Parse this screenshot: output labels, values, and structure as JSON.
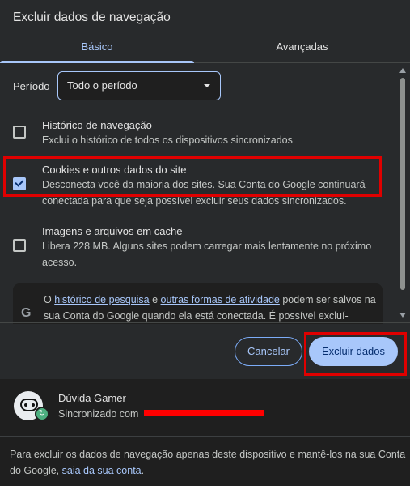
{
  "dialog": {
    "title": "Excluir dados de navegação"
  },
  "tabs": [
    {
      "label": "Básico",
      "active": true
    },
    {
      "label": "Avançadas",
      "active": false
    }
  ],
  "period": {
    "label": "Período",
    "selected": "Todo o período"
  },
  "options": [
    {
      "title": "Histórico de navegação",
      "desc": "Exclui o histórico de todos os dispositivos sincronizados",
      "checked": false
    },
    {
      "title": "Cookies e outros dados do site",
      "desc": "Desconecta você da maioria dos sites. Sua Conta do Google continuará conectada para que seja possível excluir seus dados sincronizados.",
      "checked": true
    },
    {
      "title": "Imagens e arquivos em cache",
      "desc": "Libera 228 MB. Alguns sites podem carregar mais lentamente no próximo acesso.",
      "checked": false
    }
  ],
  "info": {
    "prefix": "O ",
    "link1": "histórico de pesquisa",
    "mid": " e ",
    "link2": "outras formas de atividade",
    "suffix": " podem ser salvos na sua Conta do Google quando ela está conectada. É possível excluí-"
  },
  "buttons": {
    "cancel": "Cancelar",
    "delete": "Excluir dados"
  },
  "account": {
    "name": "Dúvida Gamer",
    "sync_prefix": "Sincronizado com"
  },
  "footnote": {
    "text": "Para excluir os dados de navegação apenas deste dispositivo e mantê-los na sua Conta do Google, ",
    "link": "saia da sua conta",
    "end": "."
  },
  "colors": {
    "accent": "#a8c7fa",
    "highlight": "#e00000",
    "background": "#282a2c"
  },
  "icons": {
    "google": "google-g-icon",
    "dropdown": "chevron-down-icon",
    "sync": "sync-icon"
  }
}
